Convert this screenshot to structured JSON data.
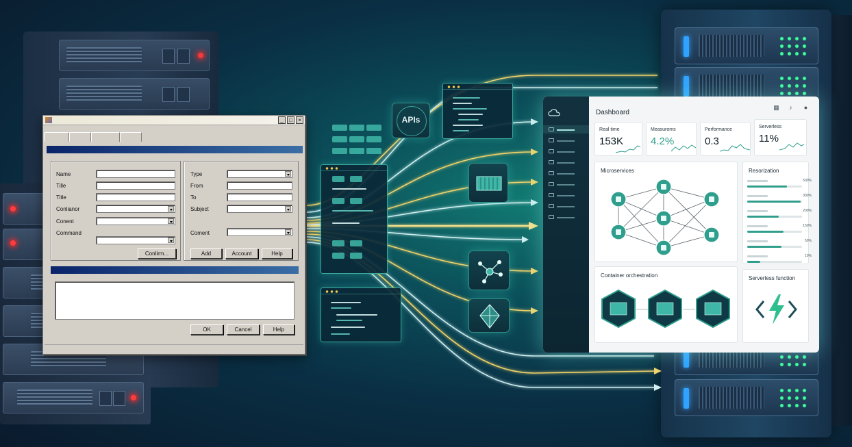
{
  "legacy_window": {
    "fields_left": [
      {
        "label": "Name"
      },
      {
        "label": "Tille"
      },
      {
        "label": "Title"
      },
      {
        "label": "Conlianor"
      },
      {
        "label": "Conent"
      },
      {
        "label": "Command"
      }
    ],
    "fields_right": [
      {
        "label": "Type"
      },
      {
        "label": "From"
      },
      {
        "label": "To"
      },
      {
        "label": "Subject"
      },
      {
        "label": "Coment"
      }
    ],
    "buttons": {
      "confirm": "Conlirm...",
      "add": "Add",
      "account": "Account",
      "help_top": "Help",
      "ok": "OK",
      "cancel": "Cancel",
      "help_bottom": "Help"
    },
    "title_controls": [
      "_",
      "□",
      "×"
    ]
  },
  "apis_label": "APIs",
  "dashboard": {
    "title": "Dashboard",
    "header_icons": [
      "calendar-icon",
      "bell-icon",
      "user-icon"
    ],
    "sidebar_logo": "cloud-icon",
    "metrics": [
      {
        "label": "Real time",
        "value": "153K",
        "highlight": false
      },
      {
        "label": "Measuroms",
        "value": "4.2%",
        "highlight": true
      },
      {
        "label": "Performance",
        "value": "0.3",
        "highlight": false
      },
      {
        "label": "Serverless",
        "value": "11%",
        "highlight": false
      }
    ],
    "microservices": {
      "title": "Microservices"
    },
    "resources": {
      "title": "Resorization",
      "rows": [
        {
          "pct": "500%",
          "fill": 0.72
        },
        {
          "pct": "300%",
          "fill": 0.98
        },
        {
          "pct": "200%",
          "fill": 0.58
        },
        {
          "pct": "150%",
          "fill": 0.66
        },
        {
          "pct": "50%",
          "fill": 0.62
        },
        {
          "pct": "10%",
          "fill": 0.24
        }
      ]
    },
    "containers": {
      "title": "Container orchestration"
    },
    "serverless": {
      "title": "Serverless function"
    }
  },
  "colors": {
    "accent": "#2f9e8c",
    "flow_yellow": "#f2d36b",
    "flow_white": "#cfeff0",
    "led_red": "#ff3b3b",
    "led_green": "#3dff9c",
    "legacy_title_blue": "#0a246a"
  }
}
